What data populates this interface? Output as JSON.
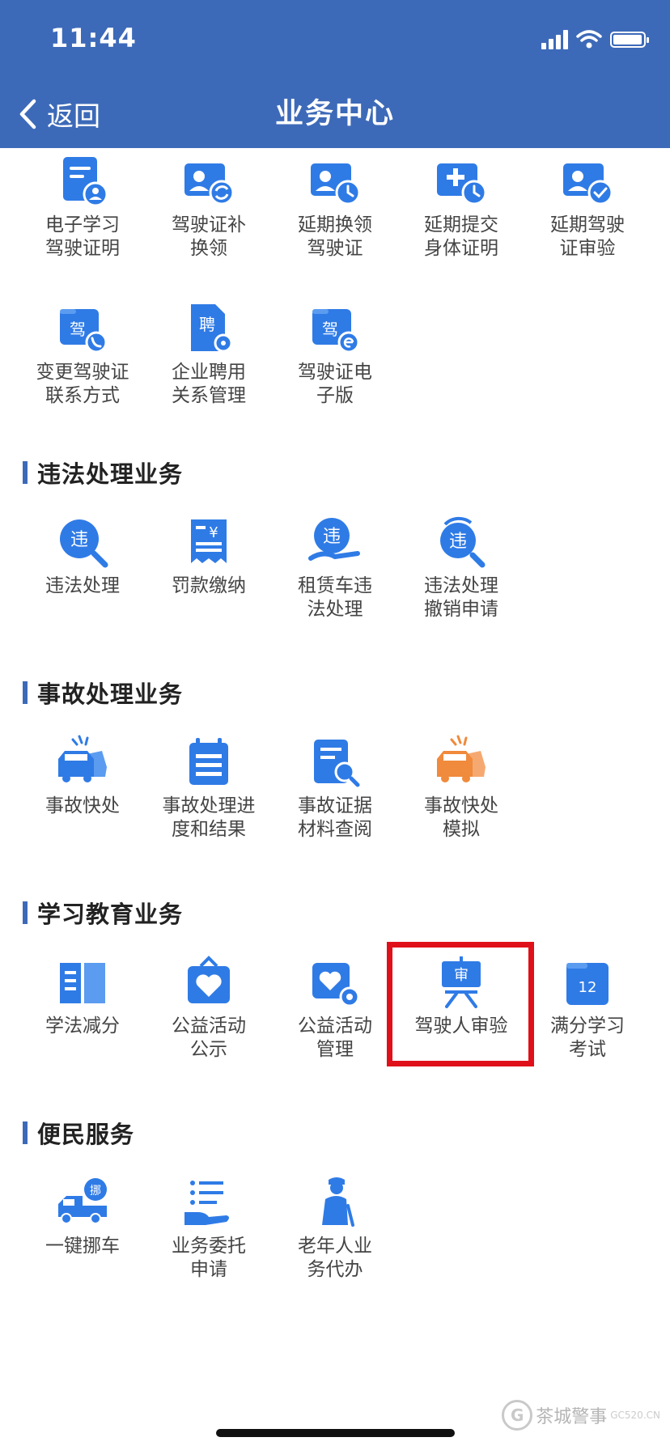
{
  "status_bar": {
    "time": "11:44"
  },
  "nav": {
    "back_label": "返回",
    "title": "业务中心"
  },
  "sections": {
    "driver_license": {
      "items": [
        {
          "label": "电子学习\n驾驶证明",
          "icon": "document-user-icon"
        },
        {
          "label": "驾驶证补\n换领",
          "icon": "license-exchange-icon"
        },
        {
          "label": "延期换领\n驾驶证",
          "icon": "license-clock-icon"
        },
        {
          "label": "延期提交\n身体证明",
          "icon": "medical-clock-icon"
        },
        {
          "label": "延期驾驶\n证审验",
          "icon": "license-check-icon"
        },
        {
          "label": "变更驾驶证\n联系方式",
          "icon": "license-phone-icon",
          "glyph": "驾"
        },
        {
          "label": "企业聘用\n关系管理",
          "icon": "employment-doc-icon",
          "glyph": "聘"
        },
        {
          "label": "驾驶证电\n子版",
          "icon": "electronic-license-icon",
          "glyph": "驾"
        }
      ]
    },
    "violation": {
      "title": "违法处理业务",
      "items": [
        {
          "label": "违法处理",
          "icon": "violation-search-icon",
          "glyph": "违"
        },
        {
          "label": "罚款缴纳",
          "icon": "fine-receipt-icon",
          "glyph": "¥"
        },
        {
          "label": "租赁车违\n法处理",
          "icon": "rental-violation-icon",
          "glyph": "违"
        },
        {
          "label": "违法处理\n撤销申请",
          "icon": "violation-revoke-icon",
          "glyph": "违"
        }
      ]
    },
    "accident": {
      "title": "事故处理业务",
      "items": [
        {
          "label": "事故快处",
          "icon": "car-crash-icon"
        },
        {
          "label": "事故处理进\n度和结果",
          "icon": "calendar-progress-icon"
        },
        {
          "label": "事故证据\n材料查阅",
          "icon": "document-search-icon"
        },
        {
          "label": "事故快处\n模拟",
          "icon": "car-crash-orange-icon"
        }
      ]
    },
    "education": {
      "title": "学习教育业务",
      "items": [
        {
          "label": "学法减分",
          "icon": "open-book-icon"
        },
        {
          "label": "公益活动\n公示",
          "icon": "charity-board-icon"
        },
        {
          "label": "公益活动\n管理",
          "icon": "charity-gear-icon"
        },
        {
          "label": "驾驶人审验",
          "icon": "review-easel-icon",
          "glyph": "审"
        },
        {
          "label": "满分学习\n考试",
          "icon": "exam-calendar-icon",
          "glyph": "12"
        }
      ]
    },
    "convenience": {
      "title": "便民服务",
      "items": [
        {
          "label": "一键挪车",
          "icon": "tow-truck-icon",
          "glyph": "挪"
        },
        {
          "label": "业务委托\n申请",
          "icon": "delegation-hand-icon"
        },
        {
          "label": "老年人业\n务代办",
          "icon": "elderly-person-icon"
        }
      ]
    }
  },
  "watermark": {
    "text": "茶城警事",
    "site": "GC520.CN",
    "logo_glyph": "G"
  },
  "colors": {
    "header": "#3d6ab8",
    "icon_blue": "#2f7be6",
    "icon_orange": "#f08a3c",
    "highlight": "#e0101a"
  }
}
